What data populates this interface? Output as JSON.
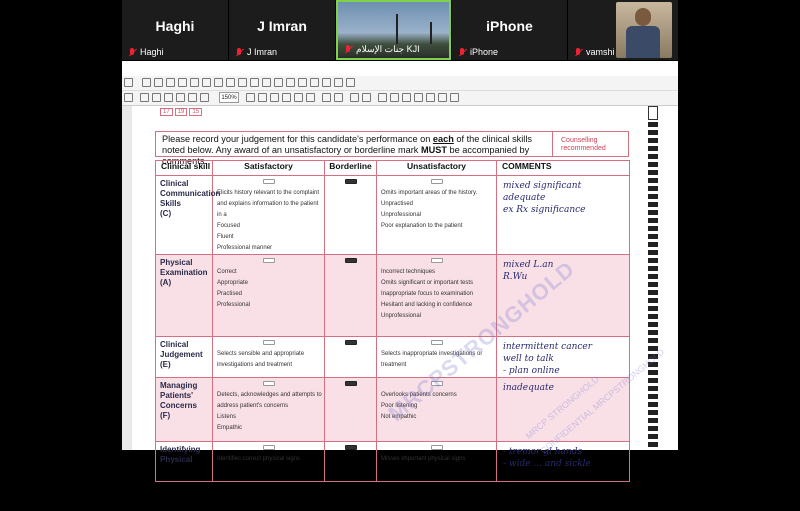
{
  "call": {
    "tiles": [
      {
        "big": "Haghi",
        "name": "Haghi"
      },
      {
        "big": "J Imran",
        "name": "J Imran"
      },
      {
        "big": "",
        "name": "جنات الإسلام KJI"
      },
      {
        "big": "iPhone",
        "name": "iPhone"
      },
      {
        "big": "",
        "name": "vamshi"
      }
    ]
  },
  "viewer": {
    "zoom": "150%",
    "icons": [
      "print-icon",
      "zoom-in-icon",
      "hand-tool-icon",
      "select-icon",
      "save-icon",
      "undo-icon",
      "redo-icon",
      "highlight-icon",
      "note-icon",
      "stamp-icon"
    ]
  },
  "form": {
    "stub": [
      "17",
      "19",
      "15"
    ],
    "instruction_1": "Please record your judgement for this candidate's performance on ",
    "instruction_each": "each",
    "instruction_2": " of the clinical skills noted below.  Any award of an unsatisfactory or borderline mark ",
    "instruction_must": "MUST",
    "instruction_3": " be accompanied by comments.",
    "counselling": "Counselling recommended",
    "headers": {
      "skill": "Clinical skill",
      "satisfactory": "Satisfactory",
      "borderline": "Borderline",
      "unsatisfactory": "Unsatisfactory",
      "comments": "COMMENTS"
    },
    "rows": [
      {
        "skill": [
          "Clinical",
          "Communication",
          "Skills",
          "(C)"
        ],
        "sat": [
          "Elicits history relevant to the complaint and explains information to the patient in a",
          "Focused",
          "Fluent",
          "Professional manner"
        ],
        "unsat": [
          "Omits important areas of the history.",
          "Unpractised",
          "Unprofessional",
          "Poor explanation to the patient"
        ],
        "comment": [
          "mixed significant",
          "adequate",
          "ex Rx significance"
        ],
        "pink": false
      },
      {
        "skill": [
          "Physical",
          "Examination",
          "(A)"
        ],
        "sat": [
          "Correct",
          "Appropriate",
          "Practised",
          "Professional"
        ],
        "unsat": [
          "Incorrect techniques",
          "Omits significant or important tests",
          "Inappropriate focus to examination",
          "Hesitant and lacking in confidence",
          "Unprofessional"
        ],
        "comment": [
          "mixed L.an",
          "R.Wu"
        ],
        "pink": true
      },
      {
        "skill": [
          "Clinical",
          "Judgement",
          "(E)"
        ],
        "sat": [
          "Selects sensible and appropriate investigations and treatment"
        ],
        "unsat": [
          "Selects inappropriate investigations or treatment"
        ],
        "comment": [
          "intermittent cancer",
          "well to talk",
          "- plan online"
        ],
        "pink": false
      },
      {
        "skill": [
          "Managing",
          "Patients'",
          "Concerns",
          "(F)"
        ],
        "sat": [
          "Detects, acknowledges and attempts to address patient's concerns",
          "Listens",
          "Empathic"
        ],
        "unsat": [
          "Overlooks patients concerns",
          "Poor listening",
          "Not empathic"
        ],
        "comment": [
          "inadequate"
        ],
        "pink": true
      },
      {
        "skill": [
          "Identifying",
          "Physical"
        ],
        "sat": [
          "Identifies correct physical signs"
        ],
        "unsat": [
          "Misses important physical signs"
        ],
        "comment": [
          "- tremor gl hands",
          "- wide ... and sickle"
        ],
        "pink": false
      }
    ],
    "watermark": [
      "MRCPSTRONGHOLD",
      "MRCP STRONGHOLD",
      "CONFIDENTIAL MRCPSTRONGHOLD"
    ]
  }
}
